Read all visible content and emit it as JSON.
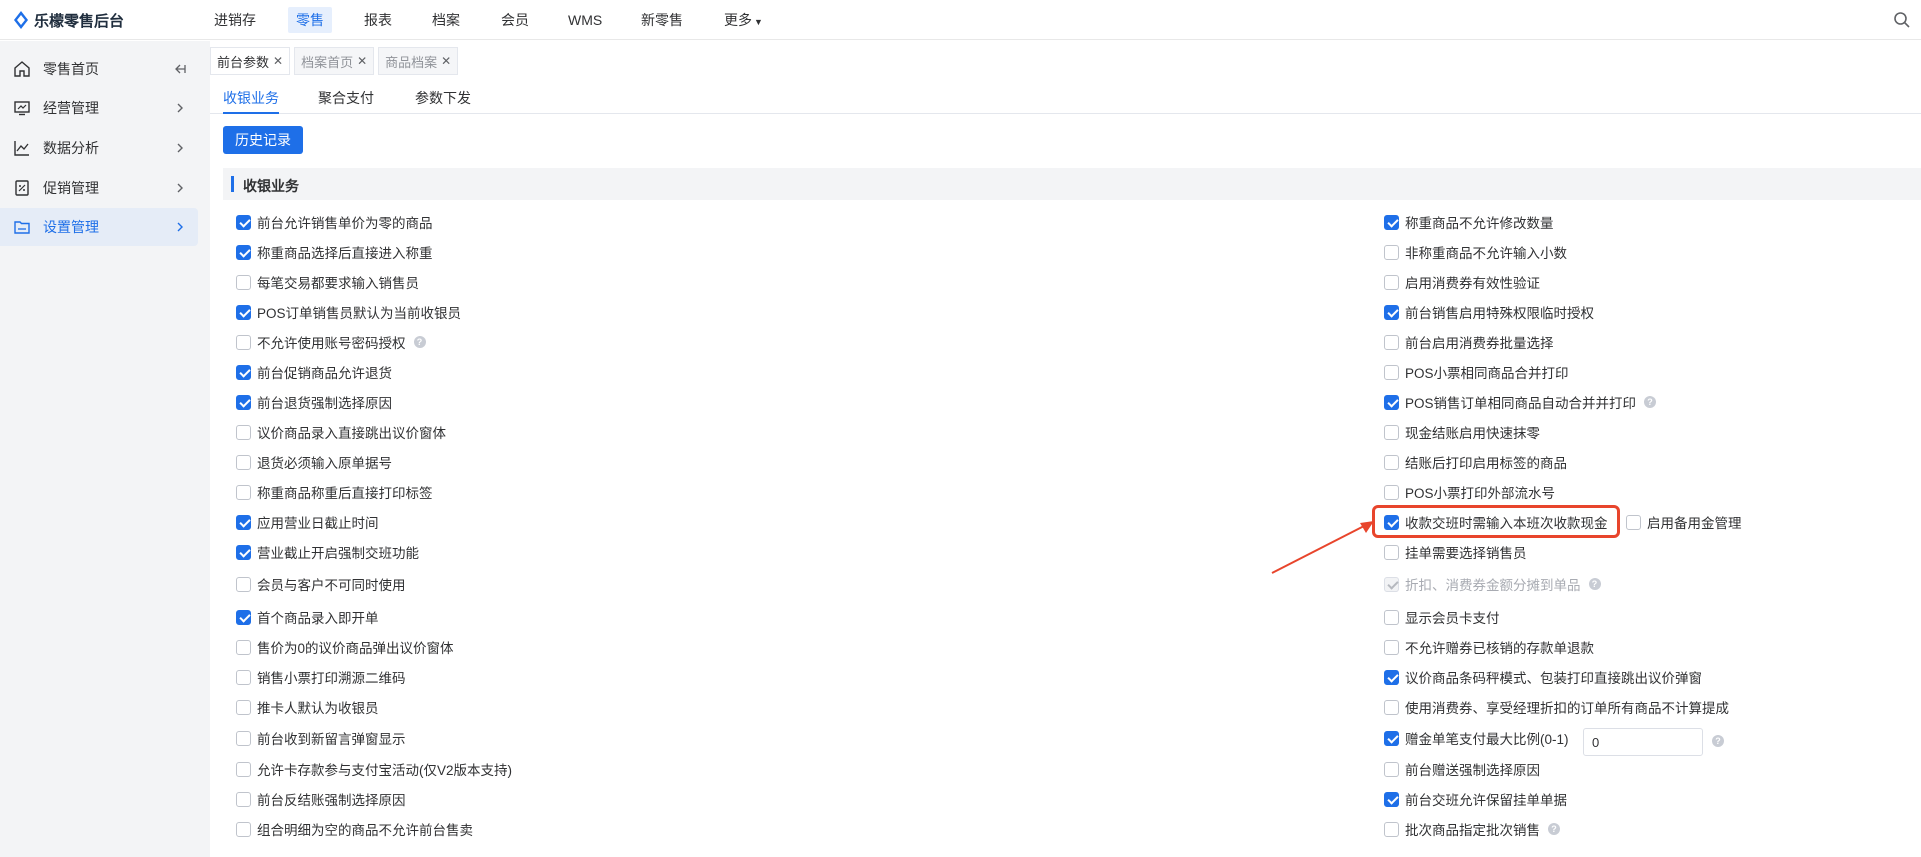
{
  "app": {
    "title": "乐檬零售后台"
  },
  "topnav": [
    "进销存",
    "零售",
    "报表",
    "档案",
    "会员",
    "WMS",
    "新零售",
    "更多"
  ],
  "sidebar": [
    {
      "label": "零售首页",
      "icon": "home-icon"
    },
    {
      "label": "经营管理",
      "icon": "monitor-icon"
    },
    {
      "label": "数据分析",
      "icon": "chart-line-icon"
    },
    {
      "label": "促销管理",
      "icon": "promotion-icon"
    },
    {
      "label": "设置管理",
      "icon": "folder-settings-icon"
    }
  ],
  "page_tabs": [
    {
      "label": "前台参数"
    },
    {
      "label": "档案首页"
    },
    {
      "label": "商品档案"
    }
  ],
  "sub_tabs": [
    "收银业务",
    "聚合支付",
    "参数下发"
  ],
  "history_btn": "历史记录",
  "section": {
    "title": "收银业务"
  },
  "left_options": [
    {
      "label": "前台允许销售单价为零的商品",
      "checked": true
    },
    {
      "label": "称重商品选择后直接进入称重",
      "checked": true
    },
    {
      "label": "每笔交易都要求输入销售员",
      "checked": false
    },
    {
      "label": "POS订单销售员默认为当前收银员",
      "checked": true
    },
    {
      "label": "不允许使用账号密码授权",
      "checked": false,
      "help": true
    },
    {
      "label": "前台促销商品允许退货",
      "checked": true
    },
    {
      "label": "前台退货强制选择原因",
      "checked": true
    },
    {
      "label": "议价商品录入直接跳出议价窗体",
      "checked": false
    },
    {
      "label": "退货必须输入原单据号",
      "checked": false
    },
    {
      "label": "称重商品称重后直接打印标签",
      "checked": false
    },
    {
      "label": "应用营业日截止时间",
      "checked": true
    },
    {
      "label": "营业截止开启强制交班功能",
      "checked": true
    },
    {
      "label": "会员与客户不可同时使用",
      "checked": false
    },
    {
      "label": "首个商品录入即开单",
      "checked": true
    },
    {
      "label": "售价为0的议价商品弹出议价窗体",
      "checked": false
    },
    {
      "label": "销售小票打印溯源二维码",
      "checked": false
    },
    {
      "label": "推卡人默认为收银员",
      "checked": false
    },
    {
      "label": "前台收到新留言弹窗显示",
      "checked": false
    },
    {
      "label": "允许卡存款参与支付宝活动(仅V2版本支持)",
      "checked": false
    },
    {
      "label": "前台反结账强制选择原因",
      "checked": false
    },
    {
      "label": "组合明细为空的商品不允许前台售卖",
      "checked": false
    }
  ],
  "right_options": [
    {
      "label": "称重商品不允许修改数量",
      "checked": true
    },
    {
      "label": "非称重商品不允许输入小数",
      "checked": false
    },
    {
      "label": "启用消费券有效性验证",
      "checked": false
    },
    {
      "label": "前台销售启用特殊权限临时授权",
      "checked": true
    },
    {
      "label": "前台启用消费券批量选择",
      "checked": false
    },
    {
      "label": "POS小票相同商品合并打印",
      "checked": false
    },
    {
      "label": "POS销售订单相同商品自动合并并打印",
      "checked": true,
      "help": true
    },
    {
      "label": "现金结账启用快速抹零",
      "checked": false
    },
    {
      "label": "结账后打印启用标签的商品",
      "checked": false
    },
    {
      "label": "POS小票打印外部流水号",
      "checked": false
    },
    {
      "label": "收款交班时需输入本班次收款现金",
      "checked": true
    },
    {
      "label": "挂单需要选择销售员",
      "checked": false
    },
    {
      "label": "折扣、消费券金额分摊到单品",
      "checked": true,
      "disabled": true,
      "help": true
    },
    {
      "label": "显示会员卡支付",
      "checked": false
    },
    {
      "label": "不允许赠券已核销的存款单退款",
      "checked": false
    },
    {
      "label": "议价商品条码秤模式、包装打印直接跳出议价弹窗",
      "checked": true
    },
    {
      "label": "使用消费券、享受经理折扣的订单所有商品不计算提成",
      "checked": false
    },
    {
      "label": "赠金单笔支付最大比例(0-1)",
      "checked": true,
      "input": "0",
      "help": true
    },
    {
      "label": "前台赠送强制选择原因",
      "checked": false
    },
    {
      "label": "前台交班允许保留挂单单据",
      "checked": true
    },
    {
      "label": "批次商品指定批次销售",
      "checked": false,
      "help": true
    }
  ],
  "extra_option": {
    "label": "启用备用金管理",
    "checked": false
  },
  "colors": {
    "accent": "#1e6fe8",
    "highlight": "#e8452c"
  }
}
